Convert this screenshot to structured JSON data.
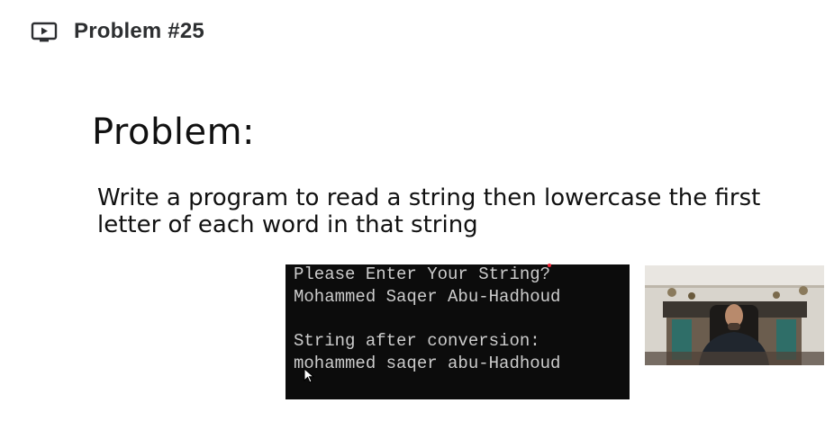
{
  "header": {
    "icon": "play-video-icon",
    "title": "Problem #25"
  },
  "slide": {
    "heading": "Problem:",
    "description": "Write a program to read a string then lowercase the first letter of each word in that string"
  },
  "console": {
    "lines": [
      "Please Enter Your String?",
      "Mohammed Saqer Abu-Hadhoud",
      "",
      "String after conversion:",
      "mohammed saqer abu-Hadhoud"
    ]
  },
  "colors": {
    "console_bg": "#0c0c0c",
    "console_text": "#cccccc",
    "title_text": "#2d2f31"
  }
}
